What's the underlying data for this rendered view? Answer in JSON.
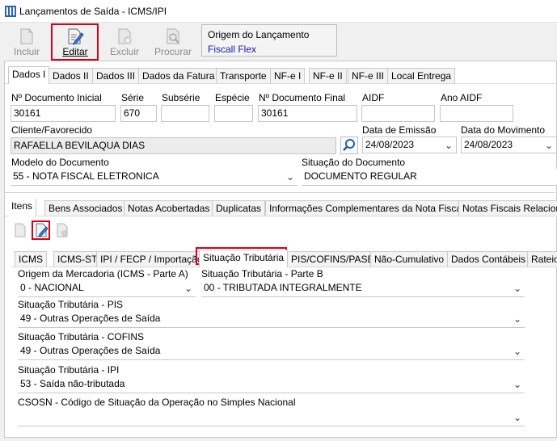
{
  "window": {
    "title": "Lançamentos de Saída - ICMS/IPI"
  },
  "toolbar": {
    "incluir": "Incluir",
    "editar": "Editar",
    "excluir": "Excluir",
    "procurar": "Procurar"
  },
  "origin": {
    "label": "Origem do Lançamento",
    "value": "Fiscall Flex"
  },
  "main_tabs": [
    "Dados I",
    "Dados II",
    "Dados III",
    "Dados da Fatura",
    "Transporte",
    "NF-e I",
    "NF-e II",
    "NF-e III",
    "Local Entrega"
  ],
  "form": {
    "num_doc_inicial": {
      "label": "Nº Documento Inicial",
      "value": "30161"
    },
    "serie": {
      "label": "Série",
      "value": "670"
    },
    "subserie": {
      "label": "Subsérie",
      "value": ""
    },
    "especie": {
      "label": "Espécie",
      "value": ""
    },
    "num_doc_final": {
      "label": "Nº Documento Final",
      "value": "30161"
    },
    "aidf": {
      "label": "AIDF",
      "value": ""
    },
    "ano_aidf": {
      "label": "Ano AIDF",
      "value": ""
    },
    "cliente": {
      "label": "Cliente/Favorecido",
      "value": "RAFAELLA BEVILAQUA DIAS"
    },
    "data_emissao": {
      "label": "Data de Emissão",
      "value": "24/08/2023"
    },
    "data_movimento": {
      "label": "Data do Movimento",
      "value": "24/08/2023"
    },
    "modelo": {
      "label": "Modelo do Documento",
      "value": "55 - NOTA FISCAL ELETRONICA"
    },
    "situacao_doc": {
      "label": "Situação do Documento",
      "value": "DOCUMENTO REGULAR"
    }
  },
  "sub_tabs": [
    "Itens",
    "Bens Associados",
    "Notas Acobertadas",
    "Duplicatas",
    "Informações Complementares da Nota Fiscal",
    "Notas Fiscais Relaciona"
  ],
  "item_tabs": [
    "ICMS",
    "ICMS-ST",
    "IPI / FECP / Importação",
    "Situação Tributária",
    "PIS/COFINS/PASEP",
    "Não-Cumulativo",
    "Dados Contábeis",
    "Rateio"
  ],
  "tributacao": {
    "origem": {
      "label": "Origem da Mercadoria (ICMS - Parte A)",
      "value": "0 - NACIONAL"
    },
    "st_b": {
      "label": "Situação Tributária - Parte B",
      "value": "00 - TRIBUTADA INTEGRALMENTE"
    },
    "pis": {
      "label": "Situação Tributária - PIS",
      "value": "49 - Outras Operações de Saída"
    },
    "cofins": {
      "label": "Situação Tributária - COFINS",
      "value": "49 - Outras Operações de Saída"
    },
    "ipi": {
      "label": "Situação Tributária - IPI",
      "value": "53 - Saída não-tributada"
    },
    "csosn": {
      "label": "CSOSN - Código de Situação da Operação no Simples Nacional",
      "value": ""
    }
  },
  "colors": {
    "highlight": "#d8001c",
    "link_blue": "#1a1aa6"
  }
}
